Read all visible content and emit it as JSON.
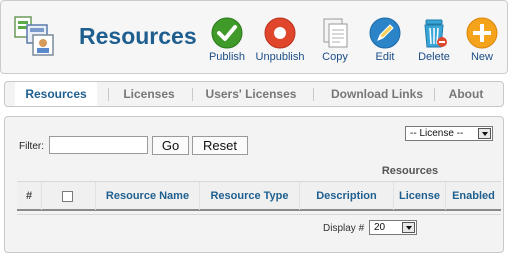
{
  "header": {
    "title": "Resources",
    "toolbar": [
      {
        "label": "Publish",
        "icon": "publish-check-icon",
        "color": "#3f9a2a"
      },
      {
        "label": "Unpublish",
        "icon": "unpublish-circle-icon",
        "color": "#e0462c"
      },
      {
        "label": "Copy",
        "icon": "copy-document-icon",
        "color": "#dddddd"
      },
      {
        "label": "Edit",
        "icon": "edit-pencil-icon",
        "color": "#2b83c8"
      },
      {
        "label": "Delete",
        "icon": "delete-trash-icon",
        "color": "#3aa6d8"
      },
      {
        "label": "New",
        "icon": "new-plus-icon",
        "color": "#f5a31a"
      }
    ]
  },
  "tabs": [
    "Resources",
    "Licenses",
    "Users' Licenses",
    "Download Links",
    "About"
  ],
  "filter": {
    "label": "Filter:",
    "value": "",
    "go_label": "Go",
    "reset_label": "Reset",
    "license_select": "-- License --"
  },
  "table": {
    "group_header": "Resources",
    "columns": [
      "#",
      "",
      "Resource Name",
      "Resource Type",
      "Description",
      "License",
      "Enabled"
    ]
  },
  "pagination": {
    "display_label": "Display #",
    "display_value": "20"
  }
}
